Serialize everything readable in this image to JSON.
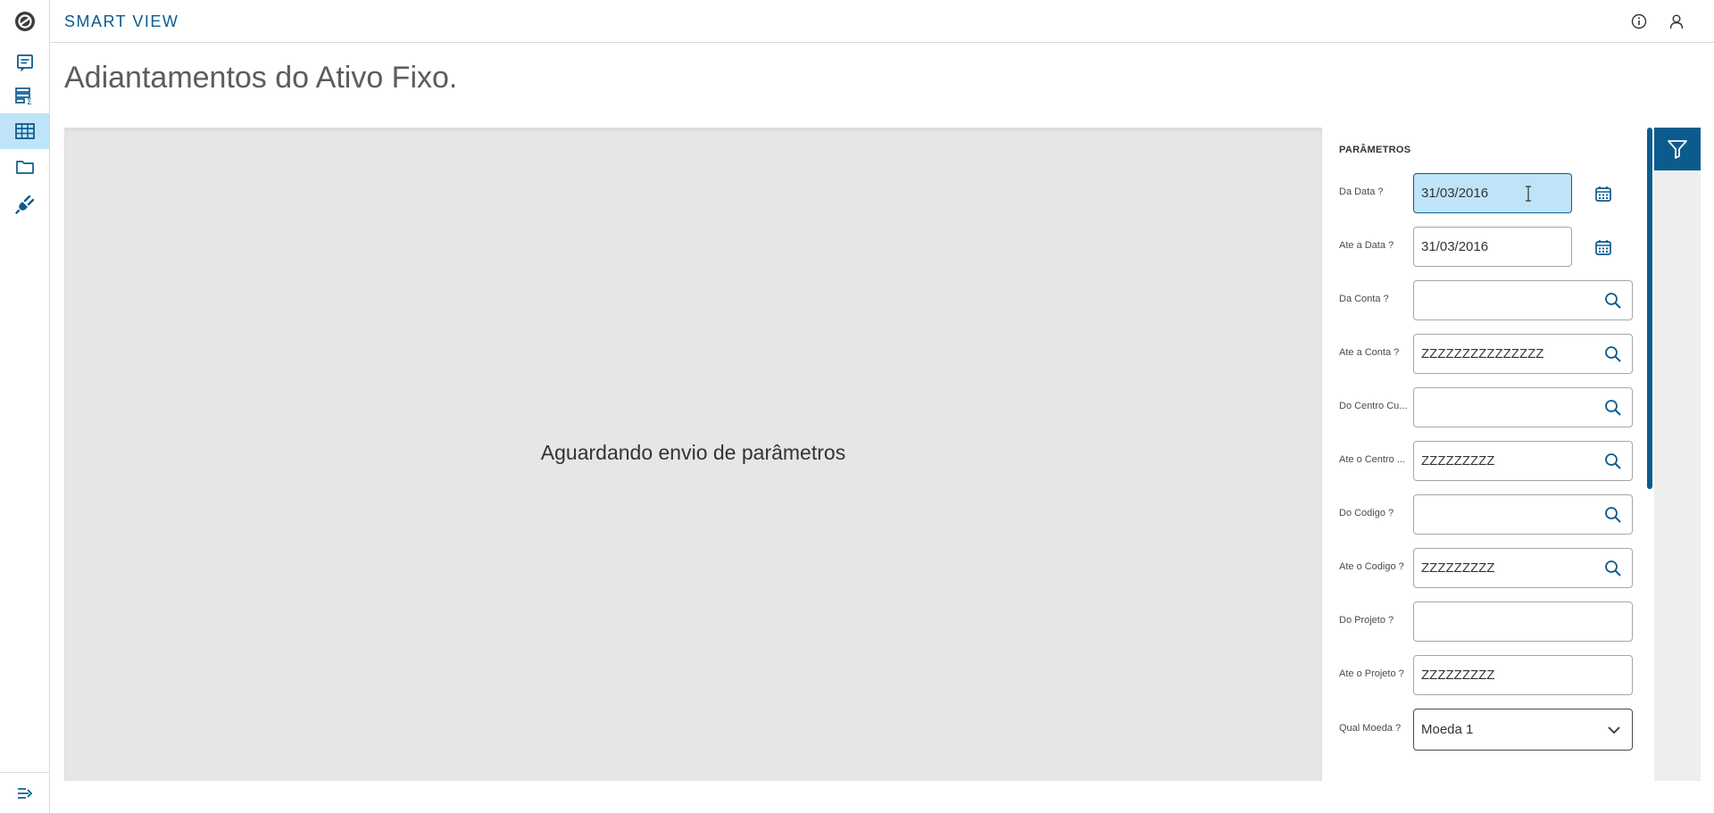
{
  "app": {
    "brand": "SMART VIEW"
  },
  "sidebar": {
    "items": [
      {
        "name": "reports-icon",
        "active": false
      },
      {
        "name": "summary-table-icon",
        "active": false
      },
      {
        "name": "grid-table-icon",
        "active": true
      },
      {
        "name": "folder-icon",
        "active": false
      },
      {
        "name": "plug-icon",
        "active": false
      }
    ],
    "collapse_icon": "menu-collapse-icon"
  },
  "header": {
    "info_icon": "info-icon",
    "user_icon": "user-icon"
  },
  "page": {
    "title": "Adiantamentos do Ativo Fixo."
  },
  "content": {
    "waiting_message": "Aguardando envio de parâmetros"
  },
  "params": {
    "title": "PARÂMETROS",
    "fields": [
      {
        "label": "Da Data ?",
        "value": "31/03/2016",
        "type": "date"
      },
      {
        "label": "Ate a Data ?",
        "value": "31/03/2016",
        "type": "date"
      },
      {
        "label": "Da Conta ?",
        "value": "",
        "type": "lookup"
      },
      {
        "label": "Ate a Conta ?",
        "value": "ZZZZZZZZZZZZZZZ",
        "type": "lookup"
      },
      {
        "label": "Do Centro Cu...",
        "value": "",
        "type": "lookup"
      },
      {
        "label": "Ate o Centro ...",
        "value": "ZZZZZZZZZ",
        "type": "lookup"
      },
      {
        "label": "Do Codigo ?",
        "value": "",
        "type": "lookup"
      },
      {
        "label": "Ate o Codigo ?",
        "value": "ZZZZZZZZZ",
        "type": "lookup"
      },
      {
        "label": "Do Projeto ?",
        "value": "",
        "type": "text"
      },
      {
        "label": "Ate o Projeto ?",
        "value": "ZZZZZZZZZ",
        "type": "text"
      },
      {
        "label": "Qual Moeda ?",
        "value": "Moeda 1",
        "type": "select"
      }
    ]
  },
  "colors": {
    "accent": "#0c5b8e",
    "active_bg": "#bfe4f9",
    "content_bg": "#e6e6e6"
  }
}
